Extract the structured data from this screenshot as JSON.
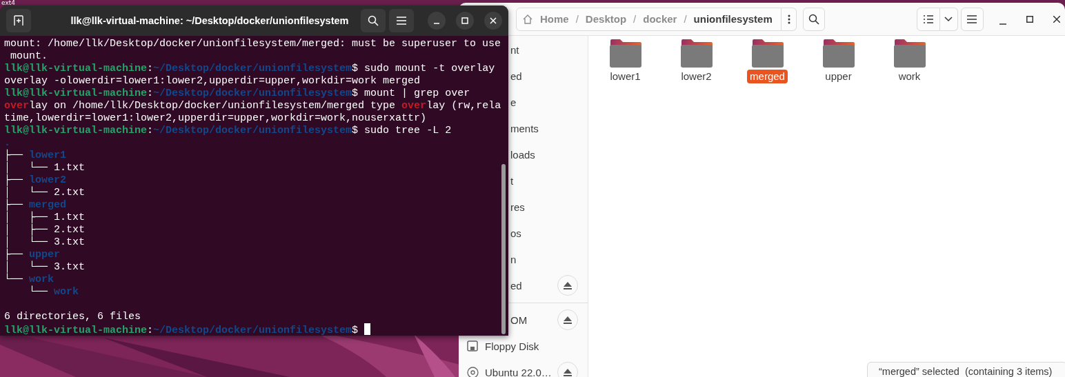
{
  "desktop": {
    "label": "ext4"
  },
  "terminal": {
    "title": "llk@llk-virtual-machine: ~/Desktop/docker/unionfilesystem",
    "lines": [
      {
        "kind": "text",
        "segments": [
          {
            "kind": "plain",
            "text": "mount: /home/llk/Desktop/docker/unionfilesystem/merged: must be superuser to use"
          }
        ]
      },
      {
        "kind": "text",
        "segments": [
          {
            "kind": "plain",
            "text": " mount."
          }
        ]
      },
      {
        "kind": "text",
        "segments": [
          {
            "kind": "user",
            "text": "llk@llk-virtual-machine"
          },
          {
            "kind": "plain",
            "text": ":"
          },
          {
            "kind": "path",
            "text": "~/Desktop/docker/unionfilesystem"
          },
          {
            "kind": "plain",
            "text": "$ sudo mount -t overlay"
          }
        ]
      },
      {
        "kind": "text",
        "segments": [
          {
            "kind": "plain",
            "text": "overlay -olowerdir=lower1:lower2,upperdir=upper,workdir=work merged"
          }
        ]
      },
      {
        "kind": "text",
        "segments": [
          {
            "kind": "user",
            "text": "llk@llk-virtual-machine"
          },
          {
            "kind": "plain",
            "text": ":"
          },
          {
            "kind": "path",
            "text": "~/Desktop/docker/unionfilesystem"
          },
          {
            "kind": "plain",
            "text": "$ mount | grep over"
          }
        ]
      },
      {
        "kind": "text",
        "segments": [
          {
            "kind": "match",
            "text": "over"
          },
          {
            "kind": "plain",
            "text": "lay on /home/llk/Desktop/docker/unionfilesystem/merged type "
          },
          {
            "kind": "match",
            "text": "over"
          },
          {
            "kind": "plain",
            "text": "lay (rw,rela"
          }
        ]
      },
      {
        "kind": "text",
        "segments": [
          {
            "kind": "plain",
            "text": "time,lowerdir=lower1:lower2,upperdir=upper,workdir=work,nouserxattr)"
          }
        ]
      },
      {
        "kind": "text",
        "segments": [
          {
            "kind": "user",
            "text": "llk@llk-virtual-machine"
          },
          {
            "kind": "plain",
            "text": ":"
          },
          {
            "kind": "path",
            "text": "~/Desktop/docker/unionfilesystem"
          },
          {
            "kind": "plain",
            "text": "$ sudo tree -L 2"
          }
        ]
      },
      {
        "kind": "text",
        "segments": [
          {
            "kind": "dir",
            "text": "."
          }
        ]
      },
      {
        "kind": "text",
        "segments": [
          {
            "kind": "plain",
            "text": "├── "
          },
          {
            "kind": "dir",
            "text": "lower1"
          }
        ]
      },
      {
        "kind": "text",
        "segments": [
          {
            "kind": "plain",
            "text": "│   └── 1.txt"
          }
        ]
      },
      {
        "kind": "text",
        "segments": [
          {
            "kind": "plain",
            "text": "├── "
          },
          {
            "kind": "dir",
            "text": "lower2"
          }
        ]
      },
      {
        "kind": "text",
        "segments": [
          {
            "kind": "plain",
            "text": "│   └── 2.txt"
          }
        ]
      },
      {
        "kind": "text",
        "segments": [
          {
            "kind": "plain",
            "text": "├── "
          },
          {
            "kind": "dir",
            "text": "merged"
          }
        ]
      },
      {
        "kind": "text",
        "segments": [
          {
            "kind": "plain",
            "text": "│   ├── 1.txt"
          }
        ]
      },
      {
        "kind": "text",
        "segments": [
          {
            "kind": "plain",
            "text": "│   ├── 2.txt"
          }
        ]
      },
      {
        "kind": "text",
        "segments": [
          {
            "kind": "plain",
            "text": "│   └── 3.txt"
          }
        ]
      },
      {
        "kind": "text",
        "segments": [
          {
            "kind": "plain",
            "text": "├── "
          },
          {
            "kind": "dir",
            "text": "upper"
          }
        ]
      },
      {
        "kind": "text",
        "segments": [
          {
            "kind": "plain",
            "text": "│   └── 3.txt"
          }
        ]
      },
      {
        "kind": "text",
        "segments": [
          {
            "kind": "plain",
            "text": "└── "
          },
          {
            "kind": "dir",
            "text": "work"
          }
        ]
      },
      {
        "kind": "text",
        "segments": [
          {
            "kind": "plain",
            "text": "    └── "
          },
          {
            "kind": "dir",
            "text": "work"
          }
        ]
      },
      {
        "kind": "blank"
      },
      {
        "kind": "text",
        "segments": [
          {
            "kind": "plain",
            "text": "6 directories, 6 files"
          }
        ]
      },
      {
        "kind": "prompt",
        "segments": [
          {
            "kind": "user",
            "text": "llk@llk-virtual-machine"
          },
          {
            "kind": "plain",
            "text": ":"
          },
          {
            "kind": "path",
            "text": "~/Desktop/docker/unionfilesystem"
          },
          {
            "kind": "plain",
            "text": "$ "
          }
        ]
      }
    ]
  },
  "files": {
    "breadcrumb": [
      {
        "label": "Home",
        "kind": "home",
        "selected": false
      },
      {
        "separator": "/",
        "label": "Desktop",
        "selected": false
      },
      {
        "separator": "/",
        "label": "docker",
        "selected": false
      },
      {
        "separator": "/",
        "label": "unionfilesystem",
        "selected": true
      }
    ],
    "sidebar": {
      "sections": [
        {
          "items": [
            {
              "label": "nt",
              "eject": false
            },
            {
              "label": "ed",
              "eject": false
            },
            {
              "label": "e",
              "eject": false
            },
            {
              "label": "ments",
              "eject": false
            },
            {
              "label": "loads",
              "eject": false
            },
            {
              "label": "t",
              "eject": false
            },
            {
              "label": "res",
              "eject": false
            },
            {
              "label": "os",
              "eject": false
            },
            {
              "label": "n",
              "eject": false
            },
            {
              "label": "ed",
              "eject": true
            }
          ]
        },
        {
          "items": [
            {
              "label": "OM",
              "eject": true
            },
            {
              "label": "Floppy Disk",
              "kind": "floppy",
              "eject": false
            },
            {
              "label": "Ubuntu 22.0…",
              "kind": "disc",
              "eject": true
            }
          ]
        }
      ]
    },
    "folders": [
      {
        "name": "lower1",
        "selected": false
      },
      {
        "name": "lower2",
        "selected": false
      },
      {
        "name": "merged",
        "selected": true
      },
      {
        "name": "upper",
        "selected": false
      },
      {
        "name": "work",
        "selected": false
      }
    ],
    "status": "“merged” selected  (containing 3 items)"
  }
}
